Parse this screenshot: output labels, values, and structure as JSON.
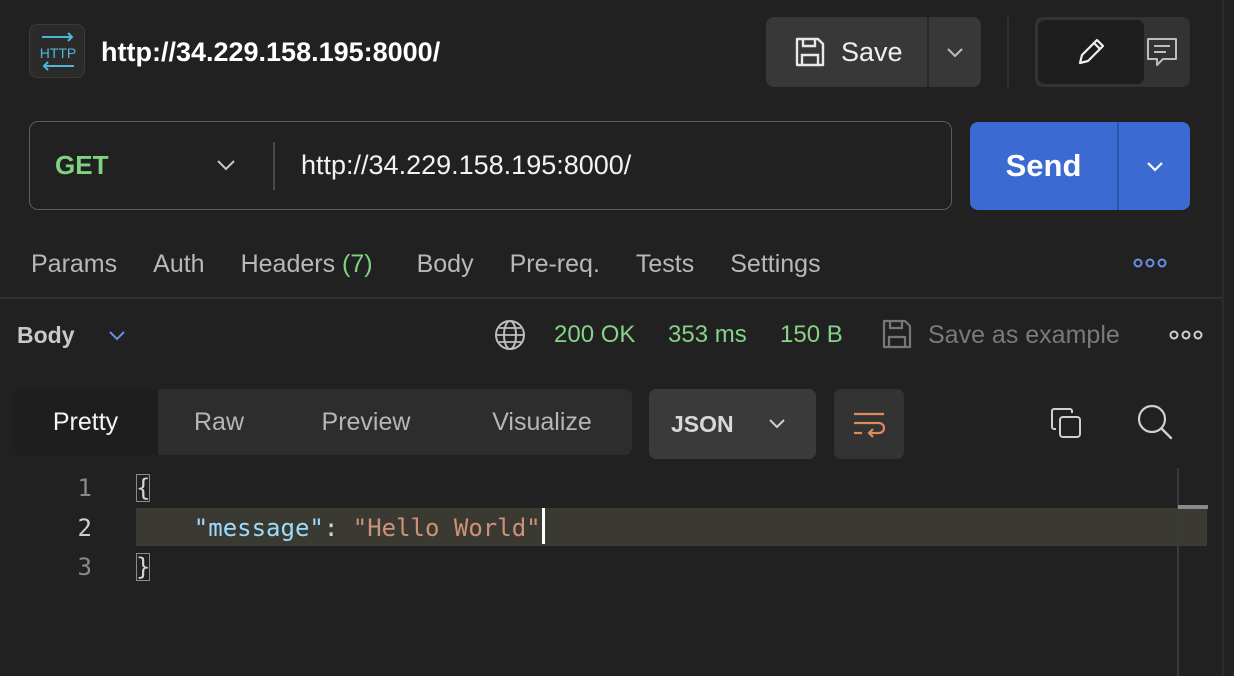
{
  "header": {
    "badge": "HTTP",
    "title": "http://34.229.158.195:8000/",
    "save_label": "Save"
  },
  "request": {
    "method": "GET",
    "url": "http://34.229.158.195:8000/",
    "send_label": "Send"
  },
  "request_tabs": {
    "params": "Params",
    "auth": "Auth",
    "headers": "Headers",
    "headers_count": "(7)",
    "body": "Body",
    "prereq": "Pre-req.",
    "tests": "Tests",
    "settings": "Settings"
  },
  "response": {
    "section_label": "Body",
    "status": "200 OK",
    "time": "353 ms",
    "size": "150 B",
    "save_example_label": "Save as example",
    "views": [
      "Pretty",
      "Raw",
      "Preview",
      "Visualize"
    ],
    "format": "JSON"
  },
  "editor": {
    "line_numbers": [
      "1",
      "2",
      "3"
    ],
    "open_brace": "{",
    "indent": "    ",
    "key": "\"message\"",
    "colon": ": ",
    "value": "\"Hello World\"",
    "close_brace": "}"
  },
  "colors": {
    "send": "#3b6ad3",
    "method": "#7fd37f",
    "status_ok": "#87d287",
    "string": "#ce9178",
    "key": "#9cdcfe"
  }
}
